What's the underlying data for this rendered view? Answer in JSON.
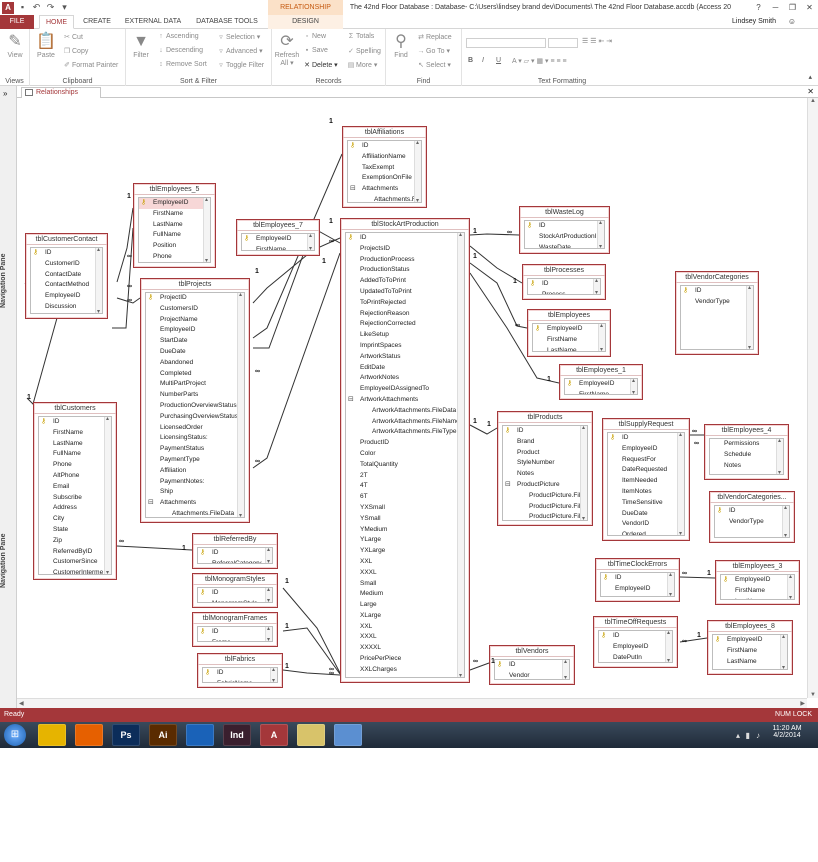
{
  "titlebar": {
    "context_tab": "RELATIONSHIP TOOLS",
    "window_title": "‪ The 42nd Floor Database : Database- C:\\Users\\lindsey brand dev\\Documents\\‪ The 42nd Floor Database.accdb (Access 20",
    "quick_access": [
      "save-icon",
      "undo-icon",
      "redo-icon",
      "customize-icon"
    ],
    "controls": [
      "?",
      "─",
      "❐",
      "✕"
    ]
  },
  "tabs": {
    "file": "FILE",
    "home": "HOME",
    "create": "CREATE",
    "external": "EXTERNAL DATA",
    "dbtools": "DATABASE TOOLS",
    "design": "DESIGN",
    "user": "Lindsey Smith"
  },
  "ribbon": {
    "views": {
      "view": "View",
      "label": "Views"
    },
    "clipboard": {
      "paste": "Paste",
      "cut": "Cut",
      "copy": "Copy",
      "format_painter": "Format Painter",
      "label": "Clipboard"
    },
    "sort": {
      "filter": "Filter",
      "ascending": "Ascending",
      "descending": "Descending",
      "remove_sort": "Remove Sort",
      "selection": "Selection",
      "advanced": "Advanced",
      "toggle_filter": "Toggle Filter",
      "label": "Sort & Filter"
    },
    "records": {
      "refresh": "Refresh",
      "refresh2": "All",
      "new": "New",
      "save": "Save",
      "delete": "Delete",
      "totals": "Totals",
      "spelling": "Spelling",
      "more": "More",
      "label": "Records"
    },
    "find": {
      "find": "Find",
      "replace": "Replace",
      "goto": "Go To",
      "select": "Select",
      "label": "Find"
    },
    "text": {
      "bold": "B",
      "italic": "I",
      "underline": "U",
      "label": "Text Formatting"
    }
  },
  "doc": {
    "tab": "Relationships",
    "nav_pane": "Navigation Pane"
  },
  "tables": [
    {
      "id": "cc",
      "title": "tblCustomerContact",
      "fields": [
        "ID",
        "CustomerID",
        "ContactDate",
        "ContactMethod",
        "EmployeeID",
        "Discussion"
      ],
      "keys": [
        0
      ]
    },
    {
      "id": "e5",
      "title": "tblEmployees_5",
      "fields": [
        "EmployeeID",
        "FirstName",
        "LastName",
        "FullName",
        "Position",
        "Phone"
      ],
      "keys": [
        0
      ],
      "sel": 0
    },
    {
      "id": "e7",
      "title": "tblEmployees_7",
      "fields": [
        "EmployeeID",
        "FirstName"
      ],
      "keys": [
        0
      ]
    },
    {
      "id": "aff",
      "title": "tblAffiliations",
      "fields": [
        "ID",
        "AffiliationName",
        "TaxExempt",
        "ExemptionOnFile",
        "Attachments",
        "Attachments.FileData"
      ],
      "keys": [
        0
      ],
      "expand": [
        4
      ],
      "subs": [
        5
      ]
    },
    {
      "id": "proj",
      "title": "tblProjects",
      "fields": [
        "ProjectID",
        "CustomersID",
        "ProjectName",
        "EmployeeID",
        "StartDate",
        "DueDate",
        "Abandoned",
        "Completed",
        "MultiPartProject",
        "NumberParts",
        "ProductionOverviewStatus",
        "PurchasingOverviewStatus",
        "LicensedOrder",
        "LicensingStatus:",
        "PaymentStatus",
        "PaymentType",
        "Affiliation",
        "PaymentNotes:",
        "Ship",
        "Attachments",
        "Attachments.FileData"
      ],
      "keys": [
        0
      ],
      "expand": [
        19
      ],
      "subs": [
        20
      ]
    },
    {
      "id": "sap",
      "title": "tblStockArtProduction",
      "fields": [
        "ID",
        "ProjectsID",
        "ProductionProcess",
        "ProductionStatus",
        "AddedToToPrint",
        "UpdatedToToPrint",
        "ToPrintRejected",
        "RejectionReason",
        "RejectionCorrected",
        "LikeSetup",
        "ImprintSpaces",
        "ArtworkStatus",
        "EditDate",
        "ArtworkNotes",
        "EmployeeIDAssignedTo",
        "ArtworkAttachments",
        "ArtworkAttachments.FileData",
        "ArtworkAttachments.FileName",
        "ArtworkAttachments.FileType",
        "ProductID",
        "Color",
        "TotalQuantity",
        "2T",
        "4T",
        "6T",
        "YXSmall",
        "YSmall",
        "YMedium",
        "YLarge",
        "YXLarge",
        "XXL",
        "XXXL",
        "Small",
        "Medium",
        "Large",
        "XLarge",
        "XXL",
        "XXXL",
        "XXXXL",
        "PricePerPiece",
        "XXLCharges",
        "AdditionalFees",
        "PurchasingStatus",
        "VendorIDPurchasing"
      ],
      "keys": [
        0
      ],
      "expand": [
        15
      ],
      "subs": [
        16,
        17,
        18
      ]
    },
    {
      "id": "cust",
      "title": "tblCustomers",
      "fields": [
        "ID",
        "FirstName",
        "LastName",
        "FullName",
        "Phone",
        "AltPhone",
        "Email",
        "Subscribe",
        "Address",
        "City",
        "State",
        "Zip",
        "ReferredByID",
        "CustomerSince",
        "CustomerInterme"
      ],
      "keys": [
        0
      ]
    },
    {
      "id": "ref",
      "title": "tblReferredBy",
      "fields": [
        "ID",
        "ReferralCategory"
      ],
      "keys": [
        0
      ]
    },
    {
      "id": "mono",
      "title": "tblMonogramStyles",
      "fields": [
        "ID",
        "MonogramStyle"
      ],
      "keys": [
        0
      ]
    },
    {
      "id": "frames",
      "title": "tblMonogramFrames",
      "fields": [
        "ID",
        "Frame"
      ],
      "keys": [
        0
      ]
    },
    {
      "id": "fab",
      "title": "tblFabrics",
      "fields": [
        "ID",
        "FabricName"
      ],
      "keys": [
        0
      ]
    },
    {
      "id": "waste",
      "title": "tblWasteLog",
      "fields": [
        "ID",
        "StockArtProductionID",
        "WasteDate"
      ],
      "keys": [
        0
      ]
    },
    {
      "id": "proc",
      "title": "tblProcesses",
      "fields": [
        "ID",
        "Process"
      ],
      "keys": [
        0
      ]
    },
    {
      "id": "emp",
      "title": "tblEmployees",
      "fields": [
        "EmployeeID",
        "FirstName",
        "LastName"
      ],
      "keys": [
        0
      ]
    },
    {
      "id": "e1",
      "title": "tblEmployees_1",
      "fields": [
        "EmployeeID",
        "FirstName"
      ],
      "keys": [
        0
      ]
    },
    {
      "id": "prod",
      "title": "tblProducts",
      "fields": [
        "ID",
        "Brand",
        "Product",
        "StyleNumber",
        "Notes",
        "ProductPicture",
        "ProductPicture.FileData",
        "ProductPicture.FileName",
        "ProductPicture.FileType"
      ],
      "keys": [
        0
      ],
      "expand": [
        5
      ],
      "subs": [
        6,
        7,
        8
      ]
    },
    {
      "id": "supply",
      "title": "tblSupplyRequest",
      "fields": [
        "ID",
        "EmployeeID",
        "RequestFor",
        "DateRequested",
        "ItemNeeded",
        "ItemNotes",
        "TimeSensitive",
        "DueDate",
        "VendorID",
        "Ordered",
        "OrderDate"
      ],
      "keys": [
        0
      ]
    },
    {
      "id": "e4",
      "title": "tblEmployees_4",
      "fields": [
        "Permissions",
        "Schedule",
        "Notes"
      ],
      "keys": []
    },
    {
      "id": "vc",
      "title": "tblVendorCategories",
      "fields": [
        "ID",
        "VendorType"
      ],
      "keys": [
        0
      ]
    },
    {
      "id": "vc1",
      "title": "tblVendorCategories...",
      "fields": [
        "ID",
        "VendorType"
      ],
      "keys": [
        0
      ]
    },
    {
      "id": "tce",
      "title": "tblTimeClockErrors",
      "fields": [
        "ID",
        "EmployeeID",
        "ReportedDate"
      ],
      "keys": [
        0
      ]
    },
    {
      "id": "e3",
      "title": "tblEmployees_3",
      "fields": [
        "EmployeeID",
        "FirstName",
        "LastName"
      ],
      "keys": [
        0
      ]
    },
    {
      "id": "tor",
      "title": "tblTimeOffRequests",
      "fields": [
        "ID",
        "EmployeeID",
        "DatePutIn",
        "DateRequested"
      ],
      "keys": [
        0
      ]
    },
    {
      "id": "e8",
      "title": "tblEmployees_8",
      "fields": [
        "EmployeeID",
        "FirstName",
        "LastName"
      ],
      "keys": [
        0
      ]
    },
    {
      "id": "ven",
      "title": "tblVendors",
      "fields": [
        "ID",
        "Vendor"
      ],
      "keys": [
        0
      ]
    }
  ],
  "relationship_marks": {
    "one": "1",
    "many": "∞"
  },
  "status": {
    "left": "Ready",
    "right": "NUM LOCK"
  },
  "taskbar": {
    "apps": [
      "explorer-icon",
      "firefox-icon",
      "photoshop-icon",
      "illustrator-icon",
      "teamviewer-icon",
      "indesign-icon",
      "access-icon",
      "notes-icon",
      "photos-icon"
    ],
    "app_labels": [
      "",
      "",
      "Ps",
      "Ai",
      "",
      "Ind",
      "A",
      "",
      ""
    ],
    "time": "11:20 AM",
    "date": "4/2/2014"
  }
}
